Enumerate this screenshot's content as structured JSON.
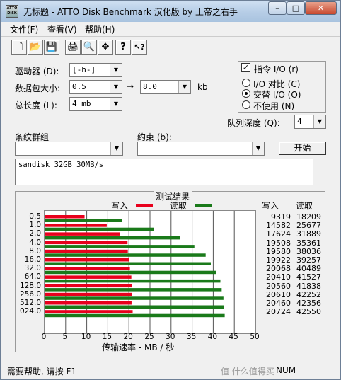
{
  "title": "无标题 - ATTO Disk Benchmark 汉化版 by 上帝之右手",
  "app_icon_text": "ATTO DISK",
  "window_controls": {
    "minimize": "–",
    "maximize": "□",
    "close": "✕"
  },
  "menu": [
    "文件(F)",
    "查看(V)",
    "帮助(H)"
  ],
  "toolbar_icons": [
    "new-icon",
    "open-icon",
    "save-icon",
    "print-icon",
    "print-preview-icon",
    "move-icon",
    "help-icon",
    "context-help-icon"
  ],
  "toolbar_glyphs": [
    "🗋",
    "📂",
    "💾",
    "🖨",
    "🔍",
    "✥",
    "?",
    "↖?"
  ],
  "form": {
    "drive_label": "驱动器 (D):",
    "drive_value": "[-h-]",
    "size_label": "数据包大小:",
    "size_from": "0.5",
    "size_arrow": "→",
    "size_to": "8.0",
    "size_unit": "kb",
    "length_label": "总长度 (L):",
    "length_value": "4 mb",
    "direct_io_label": "指令 I/O (r)",
    "direct_io_checked": true,
    "io_compare_label": "I/O 对比 (C)",
    "overlap_label": "交替 I/O (O)",
    "neither_label": "不使用 (N)",
    "selected_mode": "overlap",
    "queue_label": "队列深度 (Q):",
    "queue_value": "4",
    "stripe_label": "条纹群组",
    "stripe_value": "",
    "constraint_label": "约束 (b):",
    "constraint_value": "",
    "start_button": "开始",
    "description": "sandisk 32GB 30MB/s"
  },
  "results": {
    "section_title": "测试结果",
    "legend_write": "写入",
    "legend_read": "读取",
    "col_write": "写入",
    "col_read": "读取",
    "xlabel": "传输速率 - MB / 秒",
    "write_color": "#e8001c",
    "read_color": "#1a7a1a"
  },
  "chart_data": {
    "type": "bar",
    "orientation": "horizontal",
    "categories": [
      "0.5",
      "1.0",
      "2.0",
      "4.0",
      "8.0",
      "16.0",
      "32.0",
      "64.0",
      "128.0",
      "256.0",
      "512.0",
      "024.0"
    ],
    "series": [
      {
        "name": "写入",
        "values": [
          9319,
          14582,
          17624,
          19508,
          19580,
          19922,
          20068,
          20410,
          20560,
          20610,
          20460,
          20724
        ]
      },
      {
        "name": "读取",
        "values": [
          18209,
          25677,
          31889,
          35361,
          38036,
          39257,
          40489,
          41527,
          41838,
          42252,
          42356,
          42550
        ]
      }
    ],
    "value_unit_scale": 1000,
    "xlim": [
      0,
      50
    ],
    "xticks": [
      "0",
      "5",
      "10",
      "15",
      "20",
      "25",
      "30",
      "35",
      "40",
      "45",
      "50"
    ],
    "xlabel": "传输速率 - MB / 秒",
    "grid": true,
    "legend_placement": "top"
  },
  "status": {
    "help_text": "需要帮助, 请按 F1",
    "num": "NUM",
    "watermark": "值 什么值得买"
  }
}
